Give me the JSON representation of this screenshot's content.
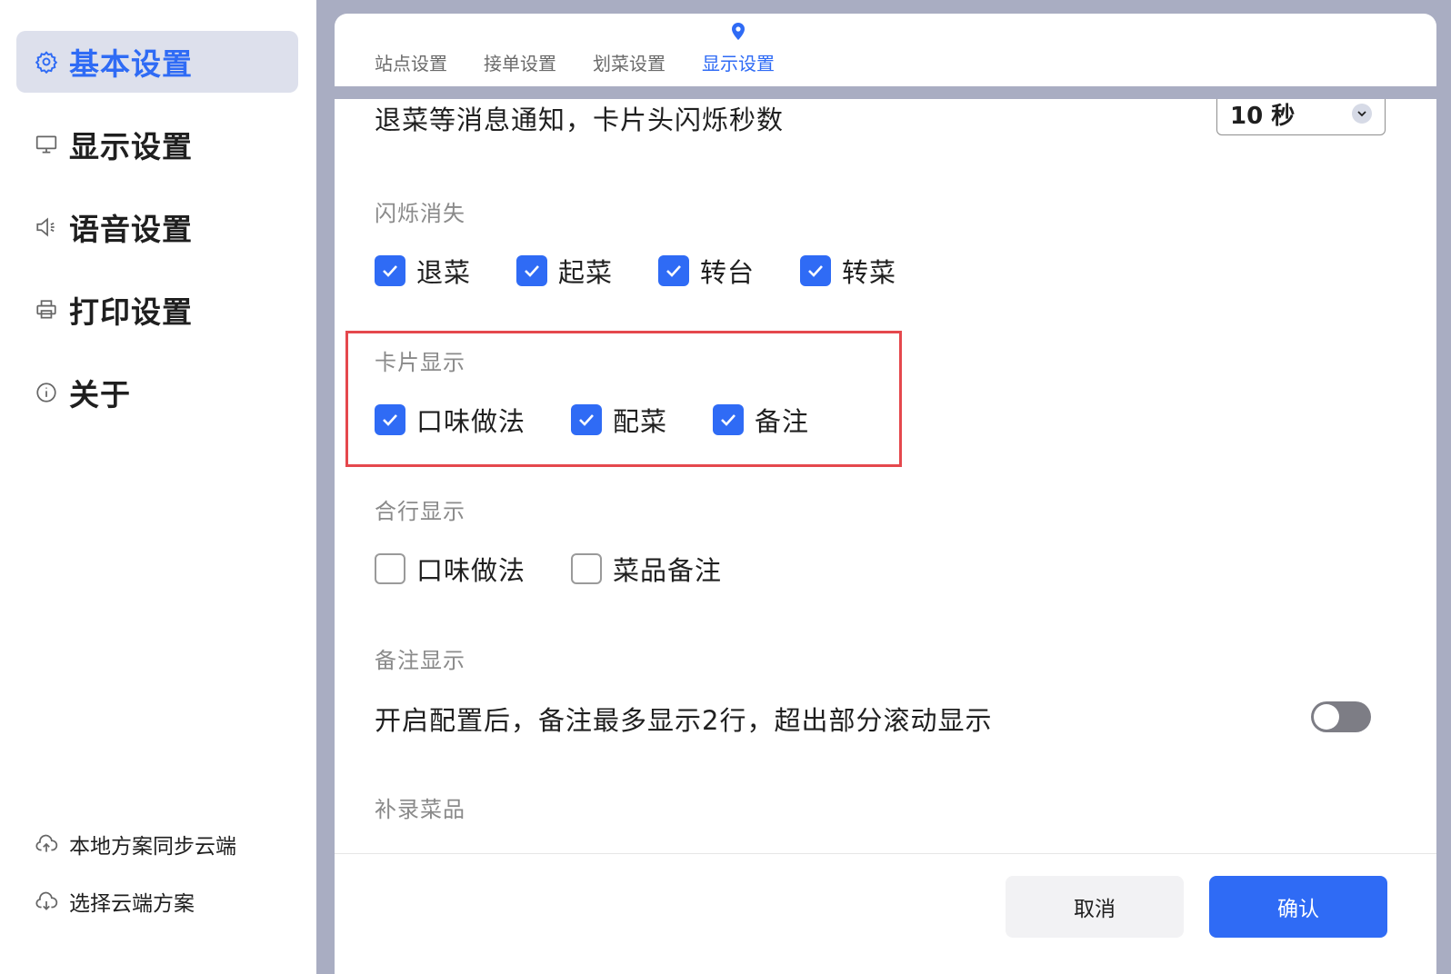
{
  "sidebar": {
    "items": [
      {
        "label": "基本设置",
        "icon": "gear-icon",
        "active": true
      },
      {
        "label": "显示设置",
        "icon": "monitor-icon"
      },
      {
        "label": "语音设置",
        "icon": "speaker-icon"
      },
      {
        "label": "打印设置",
        "icon": "printer-icon"
      },
      {
        "label": "关于",
        "icon": "info-icon"
      }
    ],
    "footer": [
      {
        "label": "本地方案同步云端",
        "icon": "cloud-upload-icon"
      },
      {
        "label": "选择云端方案",
        "icon": "cloud-download-icon"
      }
    ]
  },
  "tabs": [
    {
      "label": "站点设置"
    },
    {
      "label": "接单设置"
    },
    {
      "label": "划菜设置"
    },
    {
      "label": "显示设置",
      "active": true
    }
  ],
  "content": {
    "blink_row": {
      "label": "退菜等消息通知，卡片头闪烁秒数",
      "value": "10 秒"
    },
    "blink_dismiss": {
      "title": "闪烁消失",
      "options": [
        {
          "label": "退菜",
          "checked": true
        },
        {
          "label": "起菜",
          "checked": true
        },
        {
          "label": "转台",
          "checked": true
        },
        {
          "label": "转菜",
          "checked": true
        }
      ]
    },
    "card_display": {
      "title": "卡片显示",
      "options": [
        {
          "label": "口味做法",
          "checked": true
        },
        {
          "label": "配菜",
          "checked": true
        },
        {
          "label": "备注",
          "checked": true
        }
      ]
    },
    "merge_display": {
      "title": "合行显示",
      "options": [
        {
          "label": "口味做法",
          "checked": false
        },
        {
          "label": "菜品备注",
          "checked": false
        }
      ]
    },
    "note_display": {
      "title": "备注显示",
      "description": "开启配置后，备注最多显示2行，超出部分滚动显示",
      "enabled": false
    },
    "supplement": {
      "title": "补录菜品"
    }
  },
  "actions": {
    "cancel": "取消",
    "confirm": "确认"
  },
  "colors": {
    "accent": "#2f6bf5",
    "highlight": "#e5484d",
    "backdrop": "#a9adc2"
  }
}
